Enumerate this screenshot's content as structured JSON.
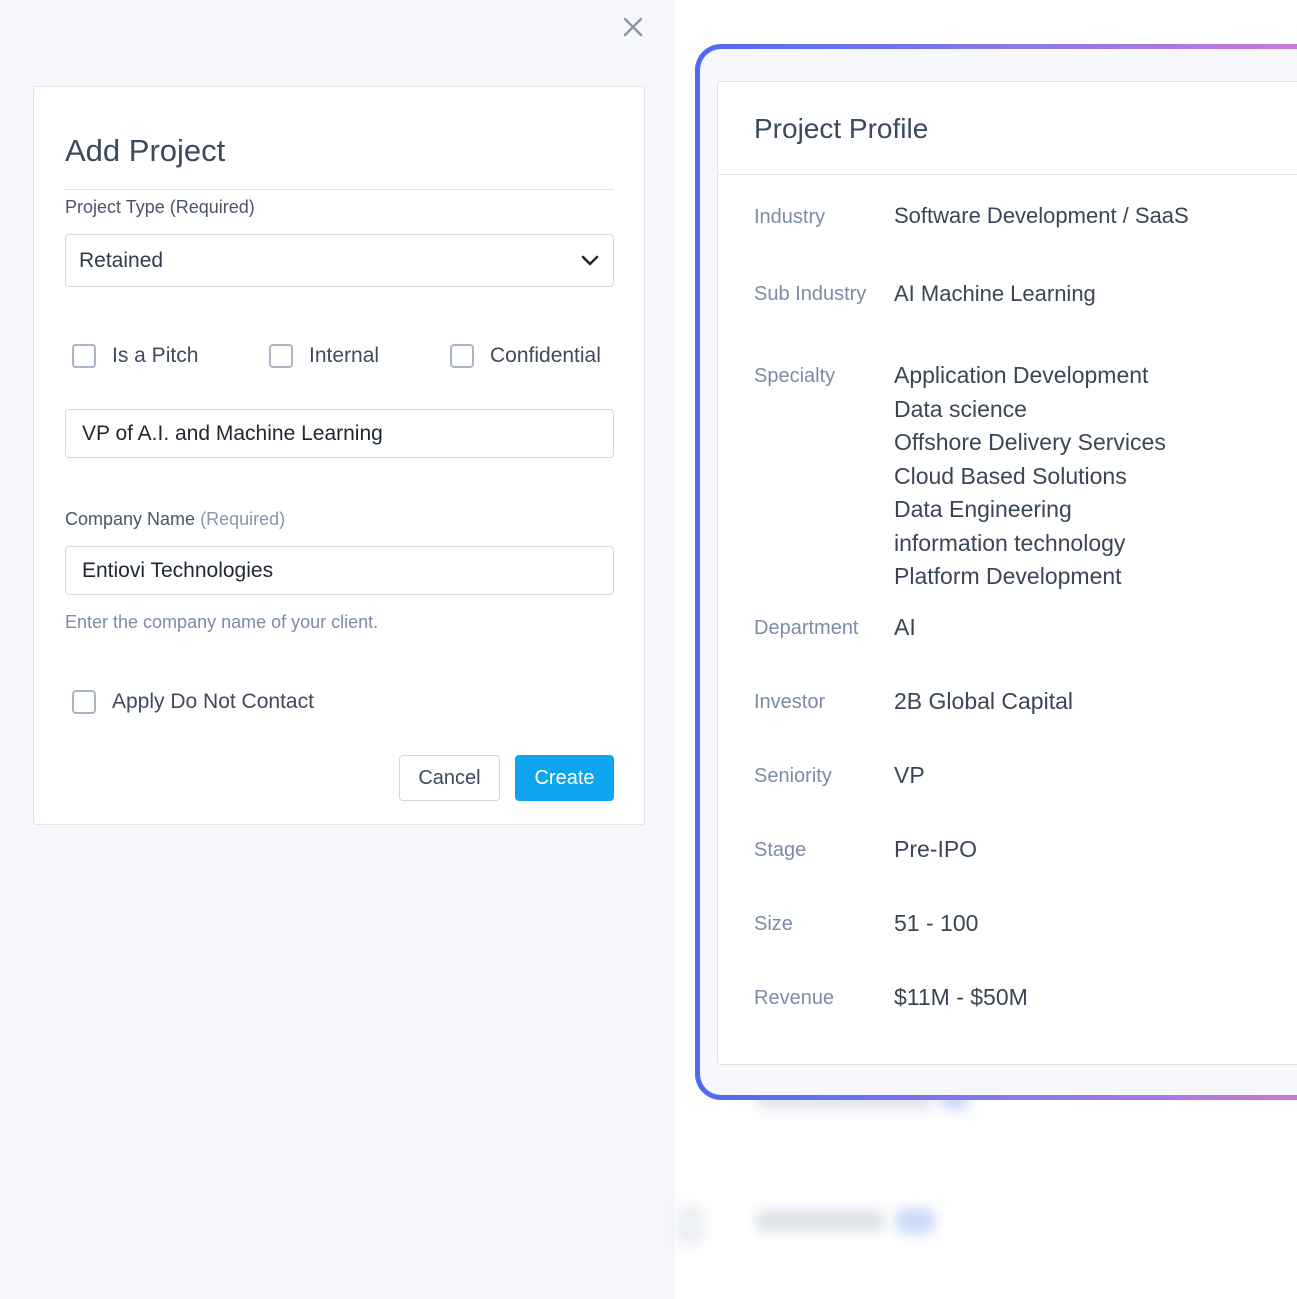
{
  "modal": {
    "title": "Add Project",
    "project_type": {
      "label": "Project Type (Required)",
      "value": "Retained"
    },
    "checkboxes": {
      "pitch": "Is a Pitch",
      "internal": "Internal",
      "confidential": "Confidential"
    },
    "project_name_value": "VP of A.I. and Machine Learning",
    "company": {
      "label": "Company Name",
      "required": "(Required)",
      "value": "Entiovi Technologies",
      "hint": "Enter the company name of your client."
    },
    "do_not_contact": "Apply Do Not Contact",
    "cancel_label": "Cancel",
    "create_label": "Create"
  },
  "profile": {
    "title": "Project Profile",
    "industry": {
      "label": "Industry",
      "value": "Software Development / SaaS"
    },
    "sub_industry": {
      "label": "Sub Industry",
      "value": "AI Machine Learning"
    },
    "specialty": {
      "label": "Specialty",
      "values": [
        "Application Development",
        "Data science",
        "Offshore Delivery Services",
        "Cloud Based Solutions",
        "Data Engineering",
        "information technology",
        "Platform Development"
      ]
    },
    "department": {
      "label": "Department",
      "value": "AI"
    },
    "investor": {
      "label": "Investor",
      "value": "2B Global Capital"
    },
    "seniority": {
      "label": "Seniority",
      "value": "VP"
    },
    "stage": {
      "label": "Stage",
      "value": "Pre-IPO"
    },
    "size": {
      "label": "Size",
      "value": "51 - 100"
    },
    "revenue": {
      "label": "Revenue",
      "value": "$11M - $50M"
    }
  },
  "colors": {
    "accent": "#0ea5f0",
    "gradient_start": "#4f6af0",
    "gradient_end": "#d477d8"
  }
}
